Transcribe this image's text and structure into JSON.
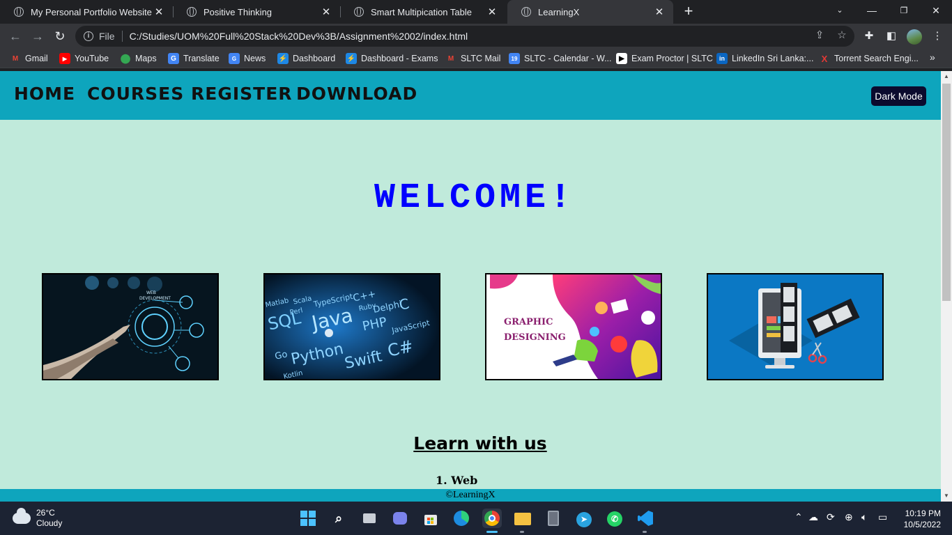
{
  "browser": {
    "tabs": [
      {
        "title": "My Personal Portfolio Website",
        "active": false
      },
      {
        "title": "Positive Thinking",
        "active": false
      },
      {
        "title": "Smart Multipication Table",
        "active": false
      },
      {
        "title": "LearningX",
        "active": true
      }
    ],
    "address": {
      "scheme": "File",
      "url": "C:/Studies/UOM%20Full%20Stack%20Dev%3B/Assignment%2002/index.html"
    },
    "bookmarks": [
      {
        "label": "Gmail",
        "icon": "gmail-icon",
        "color": "#ea4335"
      },
      {
        "label": "YouTube",
        "icon": "youtube-icon",
        "color": "#ff0000"
      },
      {
        "label": "Maps",
        "icon": "maps-icon",
        "color": "#34a853"
      },
      {
        "label": "Translate",
        "icon": "translate-icon",
        "color": "#4285f4"
      },
      {
        "label": "News",
        "icon": "news-icon",
        "color": "#4285f4"
      },
      {
        "label": "Dashboard",
        "icon": "moodle-icon",
        "color": "#1e88e5"
      },
      {
        "label": "Dashboard - Exams",
        "icon": "moodle-icon",
        "color": "#1e88e5"
      },
      {
        "label": "SLTC Mail",
        "icon": "gmail-icon",
        "color": "#ea4335"
      },
      {
        "label": "SLTC - Calendar - W...",
        "icon": "calendar-icon",
        "color": "#4285f4"
      },
      {
        "label": "Exam Proctor | SLTC",
        "icon": "proctor-icon",
        "color": "#ffffff"
      },
      {
        "label": "LinkedIn Sri Lanka:...",
        "icon": "linkedin-icon",
        "color": "#0a66c2"
      },
      {
        "label": "Torrent Search Engi...",
        "icon": "torrent-icon",
        "color": "#e53935"
      }
    ]
  },
  "site": {
    "nav": [
      "HOME",
      "COURSES",
      "REGISTER",
      "DOWNLOAD"
    ],
    "dark_mode_button": "Dark Mode",
    "welcome": "WELCOME!",
    "cards": [
      {
        "image": "web-development",
        "text": "WEB DEVELOPMENT"
      },
      {
        "image": "programming-languages",
        "words": [
          "Matlab",
          "Scala",
          "SQL",
          "Perl",
          "TypeScript",
          "C++",
          "Java",
          "Ruby",
          "Delphi",
          "PHP",
          "C",
          "Go",
          "Python",
          "Swift",
          "JavaScript",
          "C#",
          "Kotlin"
        ]
      },
      {
        "image": "graphic-designing",
        "text_line1": "Graphic",
        "text_line2": "Designing"
      },
      {
        "image": "video-editing"
      }
    ],
    "learn_title": "Learn with us",
    "list": [
      "1. Web"
    ],
    "footer": "©LearningX"
  },
  "taskbar": {
    "weather_temp": "26°C",
    "weather_desc": "Cloudy",
    "time": "10:19 PM",
    "date": "10/5/2022",
    "apps": [
      "start-icon",
      "search-icon",
      "task-view-icon",
      "chat-icon",
      "store-icon",
      "edge-icon",
      "chrome-icon",
      "file-explorer-icon",
      "calculator-icon",
      "telegram-icon",
      "whatsapp-icon",
      "vscode-icon"
    ]
  }
}
